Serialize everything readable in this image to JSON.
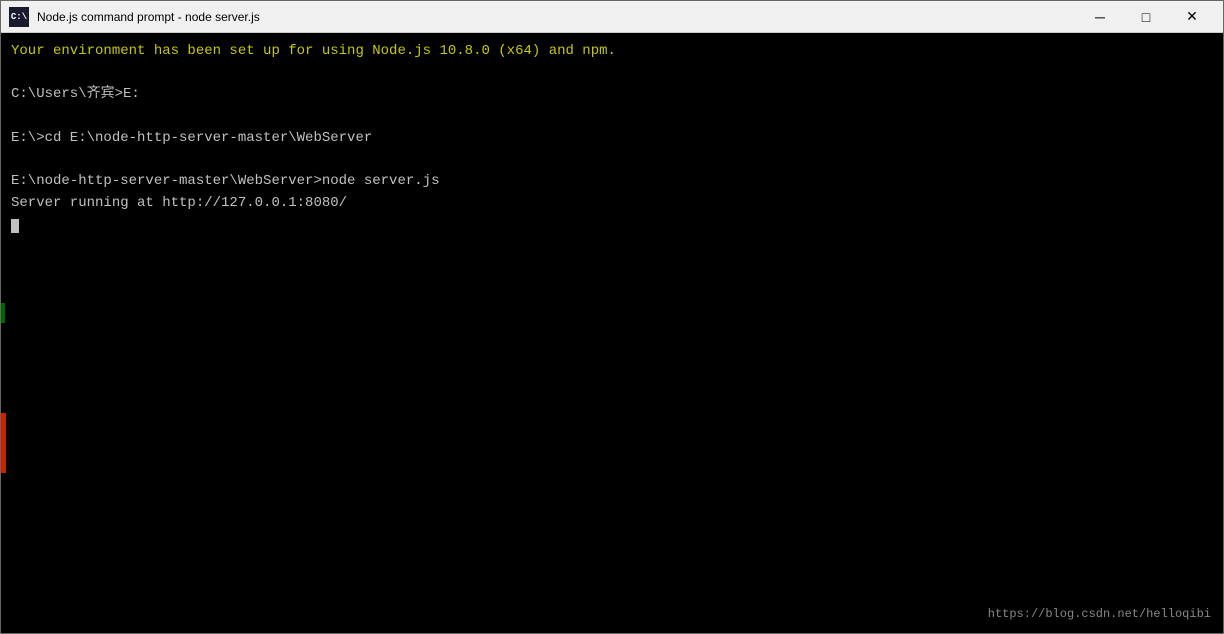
{
  "titleBar": {
    "icon": "C:\\",
    "title": "Node.js command prompt - node  server.js",
    "minimizeLabel": "─",
    "maximizeLabel": "□",
    "closeLabel": "✕"
  },
  "terminal": {
    "lines": [
      {
        "text": "Your environment has been set up for using Node.js 10.8.0 (x64) and npm.",
        "color": "yellow"
      },
      {
        "text": "",
        "color": "white"
      },
      {
        "text": "C:\\Users\\齐宾>E:",
        "color": "white"
      },
      {
        "text": "",
        "color": "white"
      },
      {
        "text": "E:\\>cd E:\\node-http-server-master\\WebServer",
        "color": "white"
      },
      {
        "text": "",
        "color": "white"
      },
      {
        "text": "E:\\node-http-server-master\\WebServer>node server.js",
        "color": "white"
      },
      {
        "text": "Server running at http://127.0.0.1:8080/",
        "color": "white"
      }
    ],
    "watermark": "https://blog.csdn.net/helloqibi"
  }
}
